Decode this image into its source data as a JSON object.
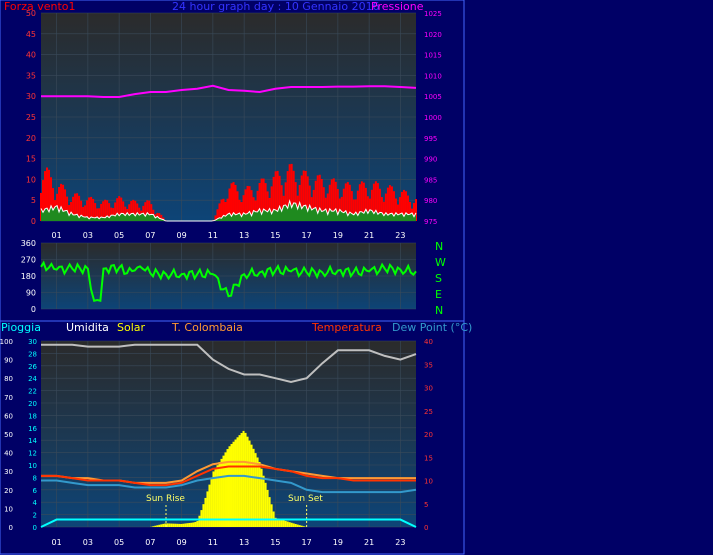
{
  "colors": {
    "background": "#000066",
    "plot_top": "#2a2a2a",
    "plot_bottom": "#0d3d66",
    "grid": "#3a4a5a",
    "wind_max": "#ff0000",
    "wind_avg": "#ffffff",
    "wind_fill": "#1f8a1f",
    "pressure": "#ff00ff",
    "direction": "#00ff00",
    "humidity": "#bfbfbf",
    "solar": "#ffff00",
    "t_colombaia": "#ff9933",
    "temperature": "#ff3300",
    "dew_point": "#3399cc",
    "rain": "#00ffff",
    "axis_text_left": "#ffffff",
    "axis_text_cyan": "#00ffff",
    "axis_text_red": "#ff3333",
    "axis_text_magenta": "#ff00ff",
    "axis_text_green": "#00ff00"
  },
  "header": {
    "wind_label": "Forza vento1",
    "title": "24 hour graph day : 10 Gennaio 2016",
    "pressure_label": "Pressione"
  },
  "legend_bottom": {
    "rain": "Pioggia",
    "humidity": "Umidita",
    "solar": "Solar",
    "t_colombaia": "T. Colombaia",
    "temperature": "Temperatura",
    "dew_point": "Dew Point (°C)"
  },
  "compass": [
    "N",
    "W",
    "S",
    "E",
    "N"
  ],
  "sun_labels": {
    "rise": "Sun Rise",
    "set": "Sun Set"
  },
  "chart_data": [
    {
      "type": "line",
      "name": "wind_pressure",
      "x_ticks": [
        "01",
        "03",
        "05",
        "07",
        "09",
        "11",
        "13",
        "15",
        "17",
        "19",
        "21",
        "23"
      ],
      "y_left": {
        "label": "Forza vento1",
        "ylim": [
          0,
          50
        ],
        "ticks": [
          0,
          5,
          10,
          15,
          20,
          25,
          30,
          35,
          40,
          45,
          50
        ]
      },
      "y_right": {
        "label": "Pressione",
        "ylim": [
          975,
          1025
        ],
        "ticks": [
          975,
          980,
          985,
          990,
          995,
          1000,
          1005,
          1010,
          1015,
          1020,
          1025
        ]
      },
      "x_hours": [
        0,
        1,
        2,
        3,
        4,
        5,
        6,
        7,
        8,
        9,
        10,
        11,
        12,
        13,
        14,
        15,
        16,
        17,
        18,
        19,
        20,
        21,
        22,
        23,
        24
      ],
      "series": [
        {
          "role": "pressure",
          "values": [
            1005,
            1005,
            1005,
            1005,
            1004.8,
            1004.8,
            1005.5,
            1006,
            1006,
            1006.5,
            1006.8,
            1007.5,
            1006.5,
            1006.3,
            1006,
            1006.8,
            1007.2,
            1007.2,
            1007.2,
            1007.3,
            1007.3,
            1007.4,
            1007.4,
            1007.2,
            1007
          ]
        },
        {
          "role": "wind_max",
          "values": [
            15,
            10,
            7,
            6,
            5,
            6,
            5,
            5,
            0,
            0,
            0,
            0,
            10,
            8,
            10,
            12,
            14,
            12,
            11,
            10,
            9,
            10,
            9,
            8,
            6
          ]
        },
        {
          "role": "wind_avg",
          "values": [
            3,
            4,
            2,
            1,
            1,
            2,
            2,
            2,
            0,
            0,
            0,
            0,
            2,
            2,
            3,
            3,
            5,
            4,
            3,
            3,
            2,
            3,
            2,
            2,
            2
          ]
        }
      ]
    },
    {
      "type": "line",
      "name": "wind_direction",
      "y_left": {
        "ylim": [
          0,
          360
        ],
        "ticks": [
          0,
          90,
          180,
          270,
          360
        ]
      },
      "x_hours": [
        0,
        0.5,
        1,
        2,
        3,
        3.4,
        3.8,
        4,
        5,
        5.5,
        6,
        6.5,
        7,
        8,
        9,
        10,
        11,
        12,
        13,
        14,
        15,
        16,
        17,
        18,
        19,
        20,
        21,
        22,
        23,
        24
      ],
      "series": [
        {
          "role": "direction",
          "values": [
            230,
            225,
            215,
            220,
            220,
            45,
            45,
            220,
            225,
            195,
            210,
            220,
            195,
            190,
            190,
            190,
            190,
            70,
            190,
            200,
            210,
            205,
            200,
            200,
            210,
            200,
            205,
            220,
            215,
            205
          ]
        }
      ]
    },
    {
      "type": "line",
      "name": "temp_hum_rain",
      "y_axes": {
        "rain": {
          "label": "Pioggia",
          "ylim": [
            0,
            30
          ],
          "ticks": [
            0,
            2,
            4,
            6,
            8,
            10,
            12,
            14,
            16,
            18,
            20,
            22,
            24,
            26,
            28,
            30
          ]
        },
        "humidity": {
          "label": "Umidita",
          "ylim": [
            0,
            100
          ],
          "ticks": [
            0,
            10,
            20,
            30,
            40,
            50,
            60,
            70,
            80,
            90,
            100
          ]
        },
        "temperature": {
          "label": "Temperatura",
          "ylim": [
            0,
            40
          ],
          "ticks": [
            0,
            5,
            10,
            15,
            20,
            25,
            30,
            35,
            40
          ]
        }
      },
      "x_hours": [
        0,
        1,
        2,
        3,
        4,
        5,
        6,
        7,
        8,
        9,
        10,
        11,
        12,
        13,
        14,
        15,
        16,
        17,
        18,
        19,
        20,
        21,
        22,
        23,
        24
      ],
      "series": [
        {
          "role": "humidity",
          "values": [
            98,
            98,
            98,
            97,
            97,
            97,
            98,
            98,
            98,
            98,
            98,
            90,
            85,
            82,
            82,
            80,
            78,
            80,
            88,
            95,
            95,
            95,
            92,
            90,
            93
          ]
        },
        {
          "role": "temperature",
          "values": [
            11,
            11,
            10.5,
            10,
            10,
            10,
            9.5,
            9,
            9,
            9.5,
            11,
            12.5,
            13,
            13,
            13,
            12.5,
            12,
            11,
            10.5,
            10.5,
            10,
            10,
            10,
            10,
            10
          ]
        },
        {
          "role": "t_colombaia",
          "values": [
            11,
            11,
            10.5,
            10.5,
            10,
            10,
            9.5,
            9.5,
            9.5,
            10,
            12,
            13.5,
            14,
            14,
            13.5,
            12.5,
            12,
            11.5,
            11,
            10.5,
            10.5,
            10.5,
            10.5,
            10.5,
            10.5
          ]
        },
        {
          "role": "dew_point",
          "values": [
            10,
            10,
            9.5,
            9,
            9,
            9,
            8.5,
            8.5,
            8.5,
            9,
            10,
            10.5,
            11,
            11,
            10.5,
            10,
            9.5,
            8,
            7.5,
            7.5,
            7.5,
            7.5,
            7.5,
            7.5,
            8
          ]
        },
        {
          "role": "solar",
          "values": [
            0,
            0,
            0,
            0,
            0,
            0,
            0,
            0,
            1,
            1,
            2,
            16,
            20,
            22,
            14,
            2,
            1,
            0,
            0,
            0,
            0,
            0,
            0,
            0,
            0
          ]
        },
        {
          "role": "rain",
          "values": [
            0,
            1.2,
            1.2,
            1.2,
            1.2,
            1.2,
            1.2,
            1.2,
            1.2,
            1.2,
            1.2,
            1.2,
            1.2,
            1.2,
            1.2,
            1.2,
            1.2,
            1.2,
            1.2,
            1.2,
            1.2,
            1.2,
            1.2,
            1.2,
            0
          ]
        }
      ],
      "sun_rise_hour": 8,
      "sun_set_hour": 17
    }
  ]
}
